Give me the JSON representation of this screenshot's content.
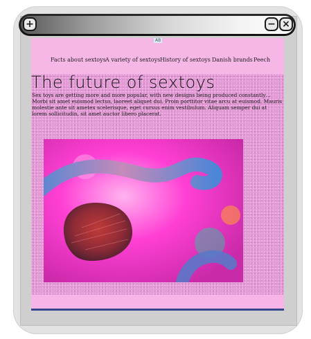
{
  "window": {
    "add_label": "+",
    "minimize_label": "−",
    "close_label": "×"
  },
  "page": {
    "badge": "AB",
    "nav": [
      {
        "label": "Facts about sextoys"
      },
      {
        "label": "A variety of sextoys"
      },
      {
        "label": "History of sextoys"
      },
      {
        "label": "Danish brands"
      },
      {
        "label": "Peech"
      }
    ],
    "title": "The future of sextoys",
    "body": "Sex toys are getting more and more popular, with new designs being produced constantly… Morbi sit amet euismod lectus, laoreet aliquet dui. Proin porttitor vitae arcu at euismod. Mauris molestie ante sit ametex scelerisque, eget cursus enim vestibulum. Aliquam semper dui at lorem sollicitudin, sit amet auctor libero placerat."
  },
  "colors": {
    "page_bg": "#f6b6e6",
    "accent_pink": "#ff2fd0",
    "accent_blue": "#4f8fd6"
  }
}
